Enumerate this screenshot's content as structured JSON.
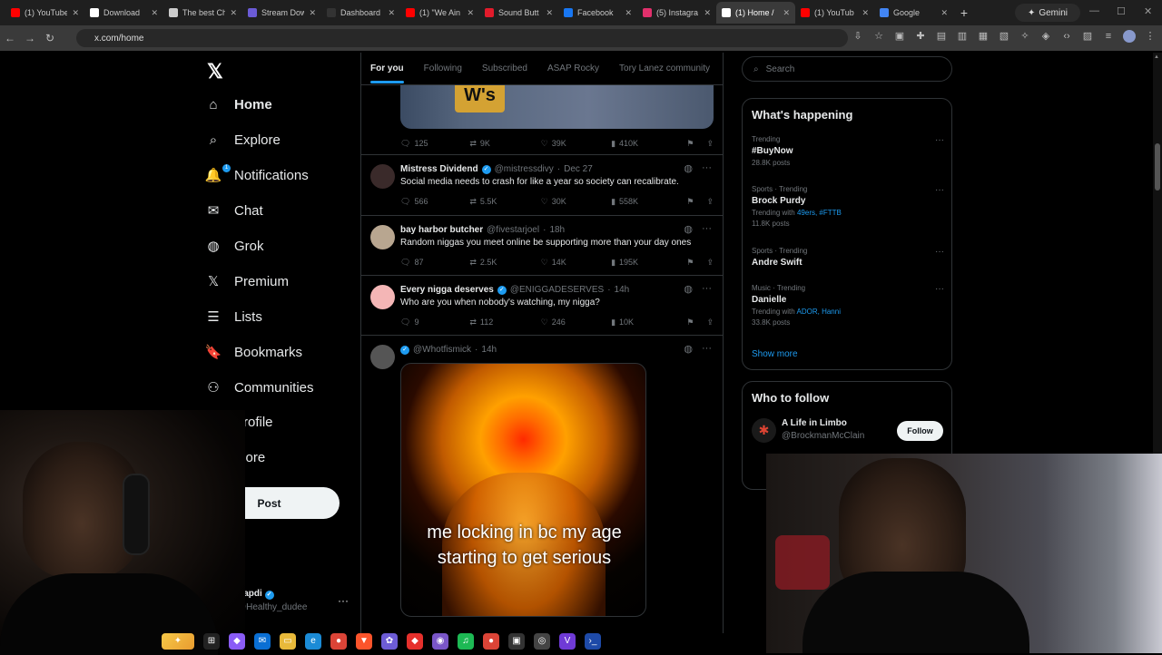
{
  "browser": {
    "tabs": [
      {
        "title": "(1) YouTube",
        "color": "#ff0000"
      },
      {
        "title": "Download",
        "color": "#ffffff"
      },
      {
        "title": "The best Ch",
        "color": "#cccccc"
      },
      {
        "title": "Stream Dow",
        "color": "#6b5bd6"
      },
      {
        "title": "Dashboard",
        "color": "#333333"
      },
      {
        "title": "(1) \"We Ain",
        "color": "#ff0000"
      },
      {
        "title": "Sound Butt",
        "color": "#e21b2b"
      },
      {
        "title": "Facebook",
        "color": "#1877f2"
      },
      {
        "title": "(5) Instagra",
        "color": "#e1306c"
      },
      {
        "title": "(1) Home /",
        "color": "#ffffff"
      },
      {
        "title": "(1) YouTub",
        "color": "#ff0000"
      },
      {
        "title": "Google",
        "color": "#4285f4"
      }
    ],
    "active_tab_index": 9,
    "gemini_label": "Gemini",
    "url": "x.com/home"
  },
  "nav": {
    "items": [
      {
        "label": "Home",
        "icon": "home-icon",
        "bold": true
      },
      {
        "label": "Explore",
        "icon": "search-icon"
      },
      {
        "label": "Notifications",
        "icon": "bell-icon",
        "badge": "1"
      },
      {
        "label": "Chat",
        "icon": "mail-icon"
      },
      {
        "label": "Grok",
        "icon": "grok-icon"
      },
      {
        "label": "Premium",
        "icon": "x-logo-icon"
      },
      {
        "label": "Lists",
        "icon": "list-icon"
      },
      {
        "label": "Bookmarks",
        "icon": "bookmark-icon"
      },
      {
        "label": "Communities",
        "icon": "people-icon"
      },
      {
        "label": "Profile",
        "icon": "person-icon"
      },
      {
        "label": "More",
        "icon": "more-circle-icon"
      }
    ],
    "post_label": "Post",
    "account": {
      "name": "Napdi",
      "handle": "@Healthy_dudee"
    }
  },
  "timeline": {
    "tabs": [
      "For you",
      "Following",
      "Subscribed",
      "ASAP Rocky",
      "Tory Lanez community"
    ],
    "active_tab": "For you",
    "top_media_text": "W's",
    "top_actions": {
      "replies": "125",
      "reposts": "9K",
      "likes": "39K",
      "views": "410K"
    },
    "tweets": [
      {
        "name": "Mistress Dividend",
        "verified": true,
        "handle": "@mistressdivy",
        "time": "Dec 27",
        "text": "Social media needs to crash for like a year so society can recalibrate.",
        "replies": "566",
        "reposts": "5.5K",
        "likes": "30K",
        "views": "558K"
      },
      {
        "name": "bay harbor butcher",
        "verified": false,
        "handle": "@fivestarjoel",
        "time": "18h",
        "text": "Random niggas you meet online be supporting more than your day ones",
        "replies": "87",
        "reposts": "2.5K",
        "likes": "14K",
        "views": "195K"
      },
      {
        "name": "Every nigga deserves",
        "verified": true,
        "handle": "@ENIGGADESERVES",
        "time": "14h",
        "text": "Who are you when nobody's watching, my nigga?",
        "replies": "9",
        "reposts": "112",
        "likes": "246",
        "views": "10K"
      },
      {
        "name": "",
        "verified": true,
        "handle": "@Whotfismick",
        "time": "14h",
        "text": "",
        "meme_caption": "me locking in bc my age starting to get serious"
      }
    ]
  },
  "sidebar": {
    "search_placeholder": "Search",
    "whats_happening_title": "What's happening",
    "trends": [
      {
        "context": "Trending",
        "title": "#BuyNow",
        "meta": "28.8K posts"
      },
      {
        "context": "Sports · Trending",
        "title": "Brock Purdy",
        "with_label": "Trending with",
        "with_links": "49ers, #FTTB",
        "meta": "11.8K posts"
      },
      {
        "context": "Sports · Trending",
        "title": "Andre Swift"
      },
      {
        "context": "Music · Trending",
        "title": "Danielle",
        "with_label": "Trending with",
        "with_links": "ADOR, Hanni",
        "meta": "33.8K posts"
      }
    ],
    "show_more": "Show more",
    "who_to_follow_title": "Who to follow",
    "follow_suggestion": {
      "name": "A Life in Limbo",
      "handle": "@BrockmanMcClain",
      "button": "Follow"
    }
  }
}
